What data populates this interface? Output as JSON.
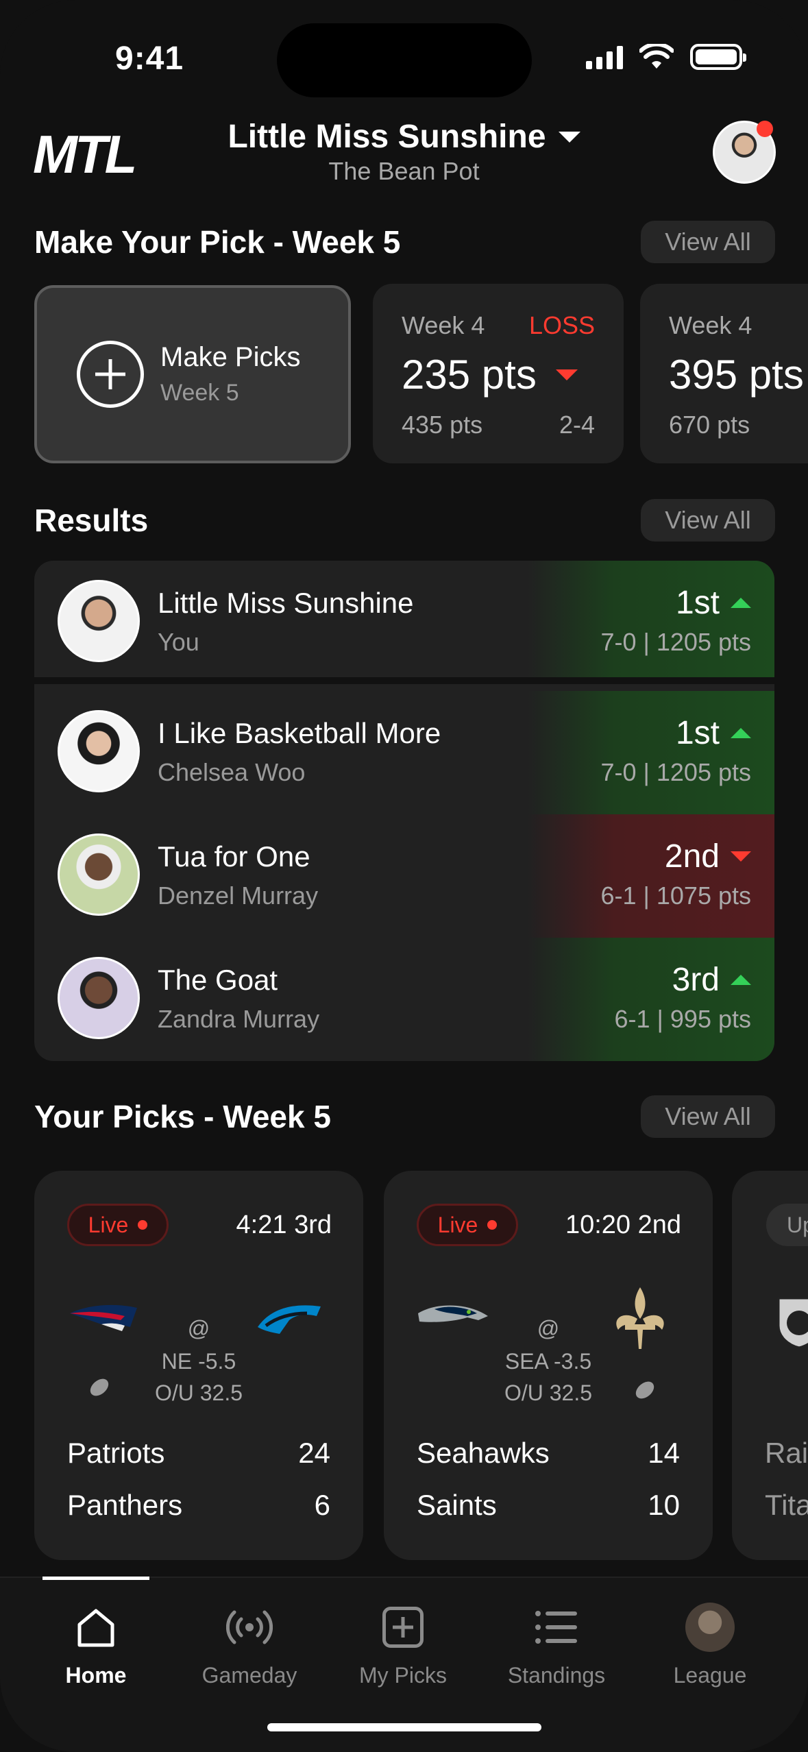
{
  "status": {
    "time": "9:41"
  },
  "header": {
    "logo": "MTL",
    "league_name": "Little Miss Sunshine",
    "league_sub": "The Bean Pot"
  },
  "make_pick": {
    "title": "Make Your Pick - Week 5",
    "view_all": "View All",
    "button_label": "Make Picks",
    "button_sub": "Week 5",
    "weeks": [
      {
        "week": "Week 4",
        "result": "LOSS",
        "points": "235 pts",
        "total": "435 pts",
        "record": "2-4"
      },
      {
        "week": "Week 4",
        "result": "",
        "points": "395 pts",
        "total": "670 pts",
        "record": ""
      }
    ]
  },
  "results": {
    "title": "Results",
    "view_all": "View All",
    "rows": [
      {
        "team": "Little Miss Sunshine",
        "owner": "You",
        "rank": "1st",
        "trend": "up",
        "record": "7-0 | 1205 pts"
      },
      {
        "team": "I Like Basketball More",
        "owner": "Chelsea Woo",
        "rank": "1st",
        "trend": "up",
        "record": "7-0 | 1205 pts"
      },
      {
        "team": "Tua for One",
        "owner": "Denzel Murray",
        "rank": "2nd",
        "trend": "down",
        "record": "6-1 | 1075 pts"
      },
      {
        "team": "The Goat",
        "owner": "Zandra Murray",
        "rank": "3rd",
        "trend": "up",
        "record": "6-1 | 995 pts"
      }
    ]
  },
  "your_picks": {
    "title": "Your Picks - Week 5",
    "view_all": "View All",
    "games": [
      {
        "status": "Live",
        "clock": "4:21 3rd",
        "at": "@",
        "spread": "NE -5.5",
        "ou": "O/U 32.5",
        "away": "Patriots",
        "away_score": "24",
        "home": "Panthers",
        "home_score": "6"
      },
      {
        "status": "Live",
        "clock": "10:20 2nd",
        "at": "@",
        "spread": "SEA -3.5",
        "ou": "O/U 32.5",
        "away": "Seahawks",
        "away_score": "14",
        "home": "Saints",
        "home_score": "10"
      },
      {
        "status": "Up",
        "away": "Rai",
        "home": "Tita"
      }
    ]
  },
  "tabs": [
    {
      "label": "Home",
      "icon": "home-icon"
    },
    {
      "label": "Gameday",
      "icon": "broadcast-icon"
    },
    {
      "label": "My Picks",
      "icon": "plus-square-icon"
    },
    {
      "label": "Standings",
      "icon": "list-icon"
    },
    {
      "label": "League",
      "icon": "league-avatar-icon"
    }
  ],
  "colors": {
    "background": "#111111",
    "card": "#212121",
    "loss_red": "#ff3b30",
    "up_green": "#34d058"
  }
}
